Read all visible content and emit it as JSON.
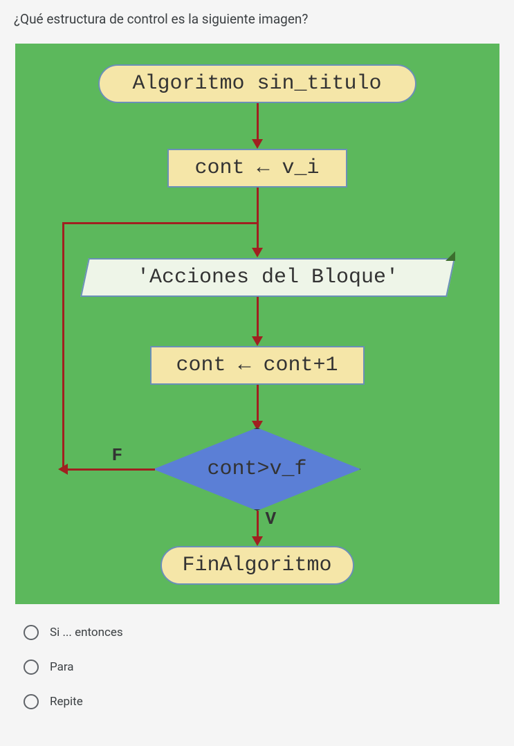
{
  "question": "¿Qué estructura de control es la siguiente imagen?",
  "flowchart": {
    "start": "Algoritmo sin_titulo",
    "init": "cont ← v_i",
    "body": "'Acciones del Bloque'",
    "increment": "cont ← cont+1",
    "condition": "cont>v_f",
    "end": "FinAlgoritmo",
    "false_label": "F",
    "true_label": "V"
  },
  "options": [
    {
      "label": "Si ... entonces"
    },
    {
      "label": "Para"
    },
    {
      "label": "Repite"
    }
  ]
}
